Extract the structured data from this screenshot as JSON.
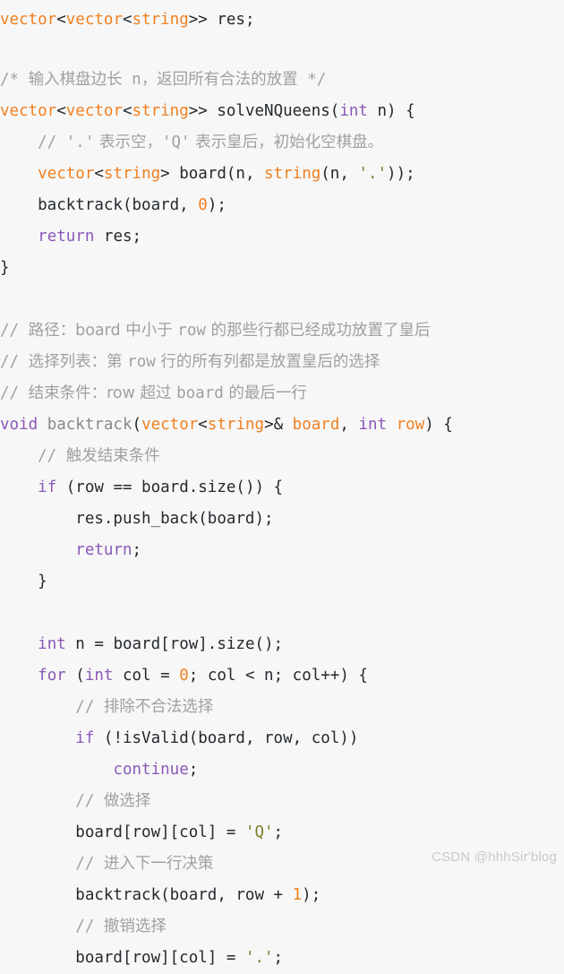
{
  "editor": {
    "language": "cpp",
    "background_color": "#f7f7f7",
    "theme_colors": {
      "type": "#f08020",
      "keyword": "#8a58b8",
      "number": "#f08020",
      "string": "#7d7d28",
      "comment": "#a0a0a0",
      "plain": "#24292e",
      "function_dim": "#8a8a8a",
      "watermark": "#c9c9c9"
    },
    "lines": [
      {
        "id": "line-1",
        "tokens": [
          {
            "t": "vector",
            "c": "type"
          },
          {
            "t": "<",
            "c": "punct"
          },
          {
            "t": "vector",
            "c": "type"
          },
          {
            "t": "<",
            "c": "punct"
          },
          {
            "t": "string",
            "c": "type"
          },
          {
            "t": ">> res;",
            "c": "plain"
          }
        ]
      },
      {
        "id": "line-2",
        "tokens": []
      },
      {
        "id": "line-3",
        "tokens": [
          {
            "t": "/* ",
            "c": "comment"
          },
          {
            "t": "输入棋盘边长",
            "c": "comment",
            "cjk": true
          },
          {
            "t": " n",
            "c": "comment"
          },
          {
            "t": "，返回所有合法的放置",
            "c": "comment",
            "cjk": true
          },
          {
            "t": " */",
            "c": "comment"
          }
        ]
      },
      {
        "id": "line-4",
        "tokens": [
          {
            "t": "vector",
            "c": "type"
          },
          {
            "t": "<",
            "c": "punct"
          },
          {
            "t": "vector",
            "c": "type"
          },
          {
            "t": "<",
            "c": "punct"
          },
          {
            "t": "string",
            "c": "type"
          },
          {
            "t": ">> solveNQueens(",
            "c": "plain"
          },
          {
            "t": "int",
            "c": "keyword"
          },
          {
            "t": " n) {",
            "c": "plain"
          }
        ]
      },
      {
        "id": "line-5",
        "tokens": [
          {
            "t": "    // ",
            "c": "comment"
          },
          {
            "t": "'.'",
            "c": "comment"
          },
          {
            "t": " 表示空，",
            "c": "comment",
            "cjk": true
          },
          {
            "t": "'Q'",
            "c": "comment"
          },
          {
            "t": " 表示皇后，初始化空棋盘。",
            "c": "comment",
            "cjk": true
          }
        ]
      },
      {
        "id": "line-6",
        "tokens": [
          {
            "t": "    ",
            "c": "plain"
          },
          {
            "t": "vector",
            "c": "type"
          },
          {
            "t": "<",
            "c": "punct"
          },
          {
            "t": "string",
            "c": "type"
          },
          {
            "t": "> board(n, ",
            "c": "plain"
          },
          {
            "t": "string",
            "c": "type"
          },
          {
            "t": "(n, ",
            "c": "plain"
          },
          {
            "t": "'.'",
            "c": "string"
          },
          {
            "t": "));",
            "c": "plain"
          }
        ]
      },
      {
        "id": "line-7",
        "tokens": [
          {
            "t": "    backtrack(board, ",
            "c": "plain"
          },
          {
            "t": "0",
            "c": "number"
          },
          {
            "t": ");",
            "c": "plain"
          }
        ]
      },
      {
        "id": "line-8",
        "tokens": [
          {
            "t": "    ",
            "c": "plain"
          },
          {
            "t": "return",
            "c": "keyword"
          },
          {
            "t": " res;",
            "c": "plain"
          }
        ]
      },
      {
        "id": "line-9",
        "tokens": [
          {
            "t": "}",
            "c": "plain"
          }
        ]
      },
      {
        "id": "line-10",
        "tokens": []
      },
      {
        "id": "line-11",
        "tokens": [
          {
            "t": "// ",
            "c": "comment"
          },
          {
            "t": "路径：board",
            "c": "comment",
            "cjk": true
          },
          {
            "t": " 中小于 ",
            "c": "comment",
            "cjk": true
          },
          {
            "t": "row",
            "c": "comment"
          },
          {
            "t": " 的那些行都已经成功放置了皇后",
            "c": "comment",
            "cjk": true
          }
        ]
      },
      {
        "id": "line-12",
        "tokens": [
          {
            "t": "// ",
            "c": "comment"
          },
          {
            "t": "选择列表：第 ",
            "c": "comment",
            "cjk": true
          },
          {
            "t": "row",
            "c": "comment"
          },
          {
            "t": " 行的所有列都是放置皇后的选择",
            "c": "comment",
            "cjk": true
          }
        ]
      },
      {
        "id": "line-13",
        "tokens": [
          {
            "t": "// ",
            "c": "comment"
          },
          {
            "t": "结束条件：row",
            "c": "comment",
            "cjk": true
          },
          {
            "t": " 超过 ",
            "c": "comment",
            "cjk": true
          },
          {
            "t": "board",
            "c": "comment"
          },
          {
            "t": " 的最后一行",
            "c": "comment",
            "cjk": true
          }
        ]
      },
      {
        "id": "line-14",
        "tokens": [
          {
            "t": "void",
            "c": "keyword"
          },
          {
            "t": " ",
            "c": "plain"
          },
          {
            "t": "backtrack",
            "c": "function_dim"
          },
          {
            "t": "(",
            "c": "plain"
          },
          {
            "t": "vector",
            "c": "type"
          },
          {
            "t": "<",
            "c": "punct"
          },
          {
            "t": "string",
            "c": "type"
          },
          {
            "t": ">& ",
            "c": "punct"
          },
          {
            "t": "board",
            "c": "type"
          },
          {
            "t": ", ",
            "c": "plain"
          },
          {
            "t": "int",
            "c": "keyword"
          },
          {
            "t": " ",
            "c": "plain"
          },
          {
            "t": "row",
            "c": "type"
          },
          {
            "t": ") {",
            "c": "plain"
          }
        ]
      },
      {
        "id": "line-15",
        "tokens": [
          {
            "t": "    // ",
            "c": "comment"
          },
          {
            "t": "触发结束条件",
            "c": "comment",
            "cjk": true
          }
        ]
      },
      {
        "id": "line-16",
        "tokens": [
          {
            "t": "    ",
            "c": "plain"
          },
          {
            "t": "if",
            "c": "keyword"
          },
          {
            "t": " (row == board.size()) {",
            "c": "plain"
          }
        ]
      },
      {
        "id": "line-17",
        "tokens": [
          {
            "t": "        res.push_back(board);",
            "c": "plain"
          }
        ]
      },
      {
        "id": "line-18",
        "tokens": [
          {
            "t": "        ",
            "c": "plain"
          },
          {
            "t": "return",
            "c": "keyword"
          },
          {
            "t": ";",
            "c": "plain"
          }
        ]
      },
      {
        "id": "line-19",
        "tokens": [
          {
            "t": "    }",
            "c": "plain"
          }
        ]
      },
      {
        "id": "line-20",
        "tokens": []
      },
      {
        "id": "line-21",
        "tokens": [
          {
            "t": "    ",
            "c": "plain"
          },
          {
            "t": "int",
            "c": "keyword"
          },
          {
            "t": " n = board[row].size();",
            "c": "plain"
          }
        ]
      },
      {
        "id": "line-22",
        "tokens": [
          {
            "t": "    ",
            "c": "plain"
          },
          {
            "t": "for",
            "c": "keyword"
          },
          {
            "t": " (",
            "c": "plain"
          },
          {
            "t": "int",
            "c": "keyword"
          },
          {
            "t": " col = ",
            "c": "plain"
          },
          {
            "t": "0",
            "c": "number"
          },
          {
            "t": "; col < n; col++) {",
            "c": "plain"
          }
        ]
      },
      {
        "id": "line-23",
        "tokens": [
          {
            "t": "        // ",
            "c": "comment"
          },
          {
            "t": "排除不合法选择",
            "c": "comment",
            "cjk": true
          }
        ]
      },
      {
        "id": "line-24",
        "tokens": [
          {
            "t": "        ",
            "c": "plain"
          },
          {
            "t": "if",
            "c": "keyword"
          },
          {
            "t": " (!isValid(board, row, col))",
            "c": "plain"
          }
        ]
      },
      {
        "id": "line-25",
        "tokens": [
          {
            "t": "            ",
            "c": "plain"
          },
          {
            "t": "continue",
            "c": "keyword"
          },
          {
            "t": ";",
            "c": "plain"
          }
        ]
      },
      {
        "id": "line-26",
        "tokens": [
          {
            "t": "        // ",
            "c": "comment"
          },
          {
            "t": "做选择",
            "c": "comment",
            "cjk": true
          }
        ]
      },
      {
        "id": "line-27",
        "tokens": [
          {
            "t": "        board[row][col] = ",
            "c": "plain"
          },
          {
            "t": "'Q'",
            "c": "string"
          },
          {
            "t": ";",
            "c": "plain"
          }
        ]
      },
      {
        "id": "line-28",
        "tokens": [
          {
            "t": "        // ",
            "c": "comment"
          },
          {
            "t": "进入下一行决策",
            "c": "comment",
            "cjk": true
          }
        ]
      },
      {
        "id": "line-29",
        "tokens": [
          {
            "t": "        backtrack(board, row + ",
            "c": "plain"
          },
          {
            "t": "1",
            "c": "number"
          },
          {
            "t": ");",
            "c": "plain"
          }
        ]
      },
      {
        "id": "line-30",
        "tokens": [
          {
            "t": "        // ",
            "c": "comment"
          },
          {
            "t": "撤销选择",
            "c": "comment",
            "cjk": true
          }
        ]
      },
      {
        "id": "line-31",
        "tokens": [
          {
            "t": "        board[row][col] = ",
            "c": "plain"
          },
          {
            "t": "'.'",
            "c": "string"
          },
          {
            "t": ";",
            "c": "plain"
          }
        ]
      }
    ]
  },
  "watermark": {
    "text": "CSDN @hhhSir'blog"
  }
}
